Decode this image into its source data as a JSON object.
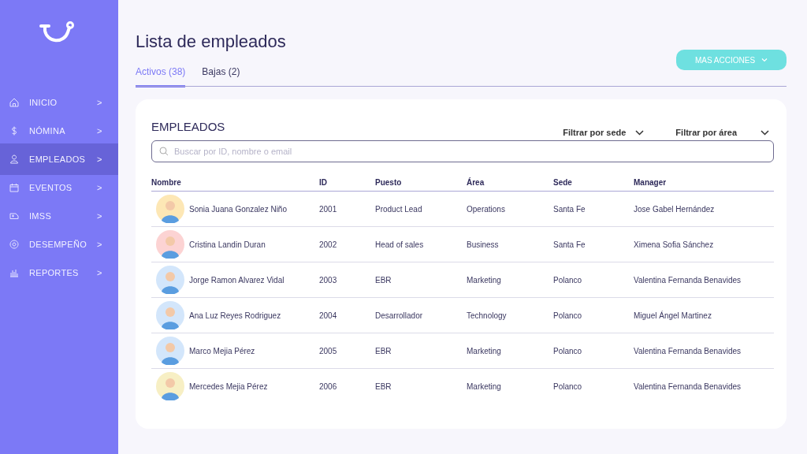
{
  "sidebar": {
    "items": [
      {
        "label": "INICIO",
        "chevron": ">",
        "selected": false
      },
      {
        "label": "NÓMINA",
        "chevron": ">",
        "selected": false
      },
      {
        "label": "EMPLEADOS",
        "chevron": ">",
        "selected": true
      },
      {
        "label": "EVENTOS",
        "chevron": ">",
        "selected": false
      },
      {
        "label": "IMSS",
        "chevron": ">",
        "selected": false
      },
      {
        "label": "DESEMPEÑO",
        "chevron": ">",
        "selected": false
      },
      {
        "label": "REPORTES",
        "chevron": ">",
        "selected": false
      }
    ]
  },
  "page": {
    "title": "Lista de empleados",
    "action_button": "MAS ACCIONES",
    "tabs": [
      {
        "label": "Activos (38)",
        "selected": true
      },
      {
        "label": "Bajas (2)",
        "selected": false
      }
    ]
  },
  "card": {
    "title": "EMPLEADOS",
    "filters": [
      "Filtrar por sede",
      "Filtrar por área"
    ],
    "search": {
      "placeholder": "Buscar por ID, nombre o email"
    },
    "table": {
      "columns": [
        "Nombre",
        "ID",
        "Puesto",
        "Área",
        "Sede",
        "Manager"
      ],
      "rows": [
        {
          "color": "#fde7b5",
          "cells": [
            "Sonia Juana Gonzalez Niño",
            "2001",
            "Product Lead",
            "Operations",
            "Santa Fe",
            "Jose Gabel Hernández"
          ]
        },
        {
          "color": "#fcd3d3",
          "cells": [
            "Cristina Landin Duran",
            "2002",
            "Head of sales",
            "Business",
            "Santa Fe",
            "Ximena Sofia Sánchez"
          ]
        },
        {
          "color": "#d3e6fb",
          "cells": [
            "Jorge Ramon Alvarez Vidal",
            "2003",
            "EBR",
            "Marketing",
            "Polanco",
            "Valentina Fernanda Benavides"
          ]
        },
        {
          "color": "#d3e6fb",
          "cells": [
            "Ana Luz Reyes Rodriguez",
            "2004",
            "Desarrollador",
            "Technology",
            "Polanco",
            "Miguel Ángel Martinez"
          ]
        },
        {
          "color": "#d3e6fb",
          "cells": [
            "Marco Mejia Pérez",
            "2005",
            "EBR",
            "Marketing",
            "Polanco",
            "Valentina Fernanda Benavides"
          ]
        },
        {
          "color": "#f7efc4",
          "cells": [
            "Mercedes Mejia Pérez",
            "2006",
            "EBR",
            "Marketing",
            "Polanco",
            "Valentina Fernanda Benavides"
          ]
        }
      ]
    }
  }
}
